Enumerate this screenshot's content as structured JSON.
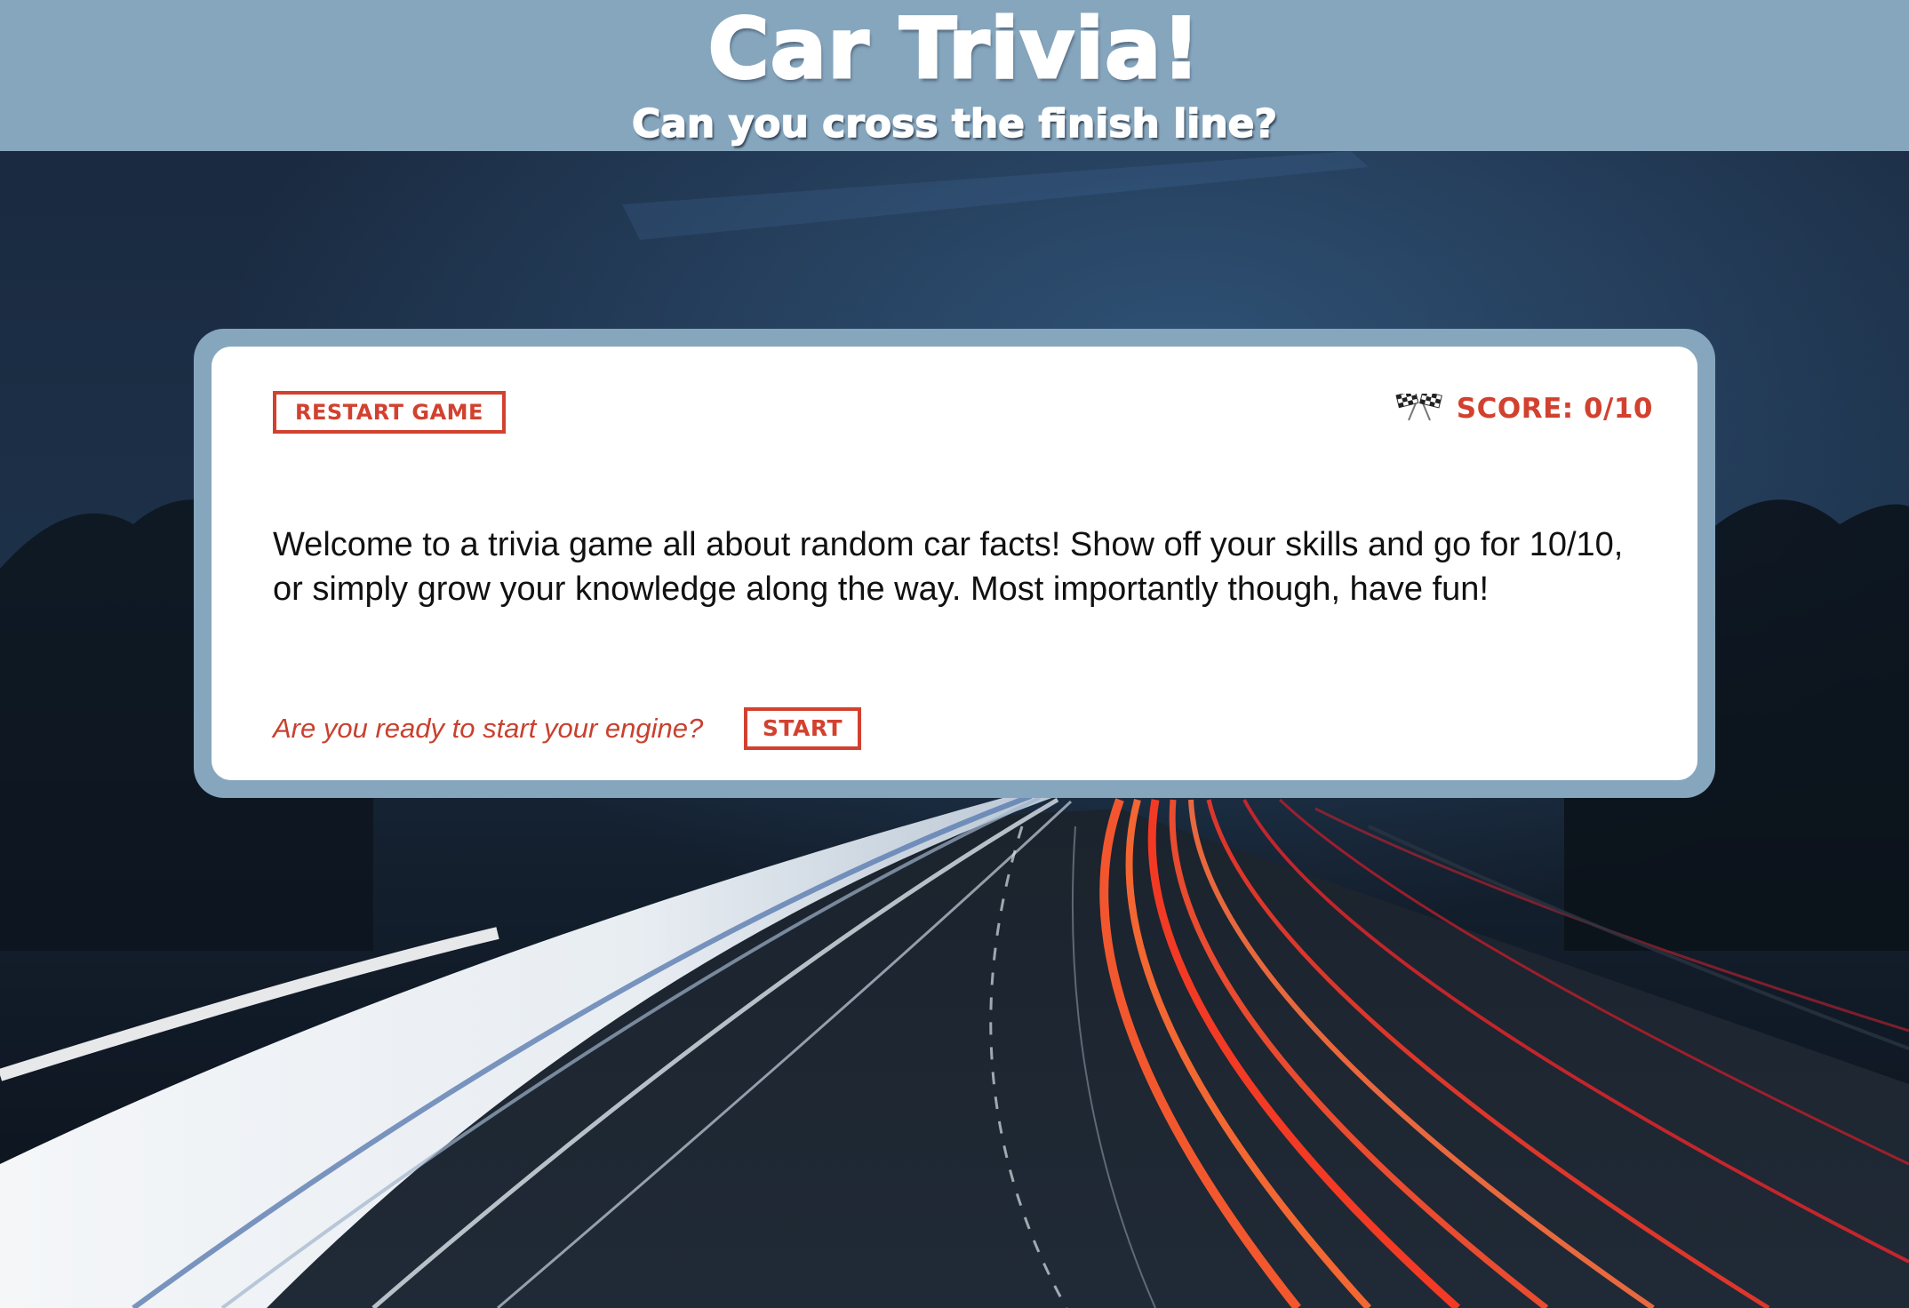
{
  "header": {
    "title": "Car Trivia!",
    "subtitle": "Can you cross the finish line?"
  },
  "game": {
    "restart_label": "RESTART GAME",
    "score_icon": "checkered-flags-icon",
    "score_label": "SCORE: 0/10",
    "welcome_message": "Welcome to a trivia game all about random car facts! Show off your skills and go for 10/10, or simply grow your knowledge along the way. Most importantly though, have fun!",
    "ready_prompt": "Are you ready to start your engine?",
    "start_label": "START"
  },
  "colors": {
    "header_bg": "#86a6be",
    "accent_red": "#d2412f",
    "card_bg": "#ffffff"
  }
}
